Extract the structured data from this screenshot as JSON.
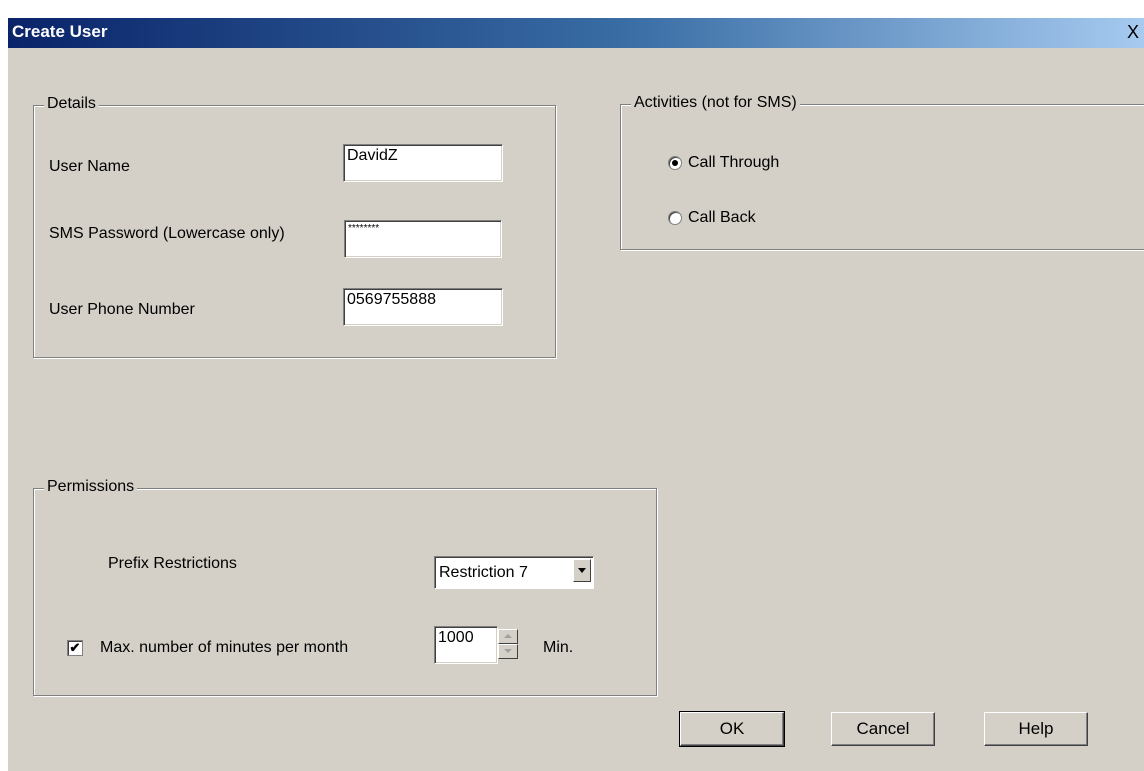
{
  "window": {
    "title": "Create User",
    "close_glyph": "X"
  },
  "details": {
    "legend": "Details",
    "user_name_label": "User Name",
    "user_name_value": "DavidZ",
    "sms_password_label": "SMS Password (Lowercase only)",
    "sms_password_value": "********",
    "phone_label": "User Phone Number",
    "phone_value": "0569755888"
  },
  "activities": {
    "legend": "Activities (not for SMS)",
    "options": [
      {
        "label": "Call Through",
        "selected": true
      },
      {
        "label": "Call Back",
        "selected": false
      }
    ]
  },
  "permissions": {
    "legend": "Permissions",
    "prefix_label": "Prefix Restrictions",
    "prefix_value": "Restriction 7",
    "max_minutes_checked": true,
    "max_minutes_check_glyph": "✔",
    "max_minutes_label": "Max. number of minutes per month",
    "max_minutes_value": "1000",
    "unit": "Min."
  },
  "buttons": {
    "ok": "OK",
    "cancel": "Cancel",
    "help": "Help"
  }
}
